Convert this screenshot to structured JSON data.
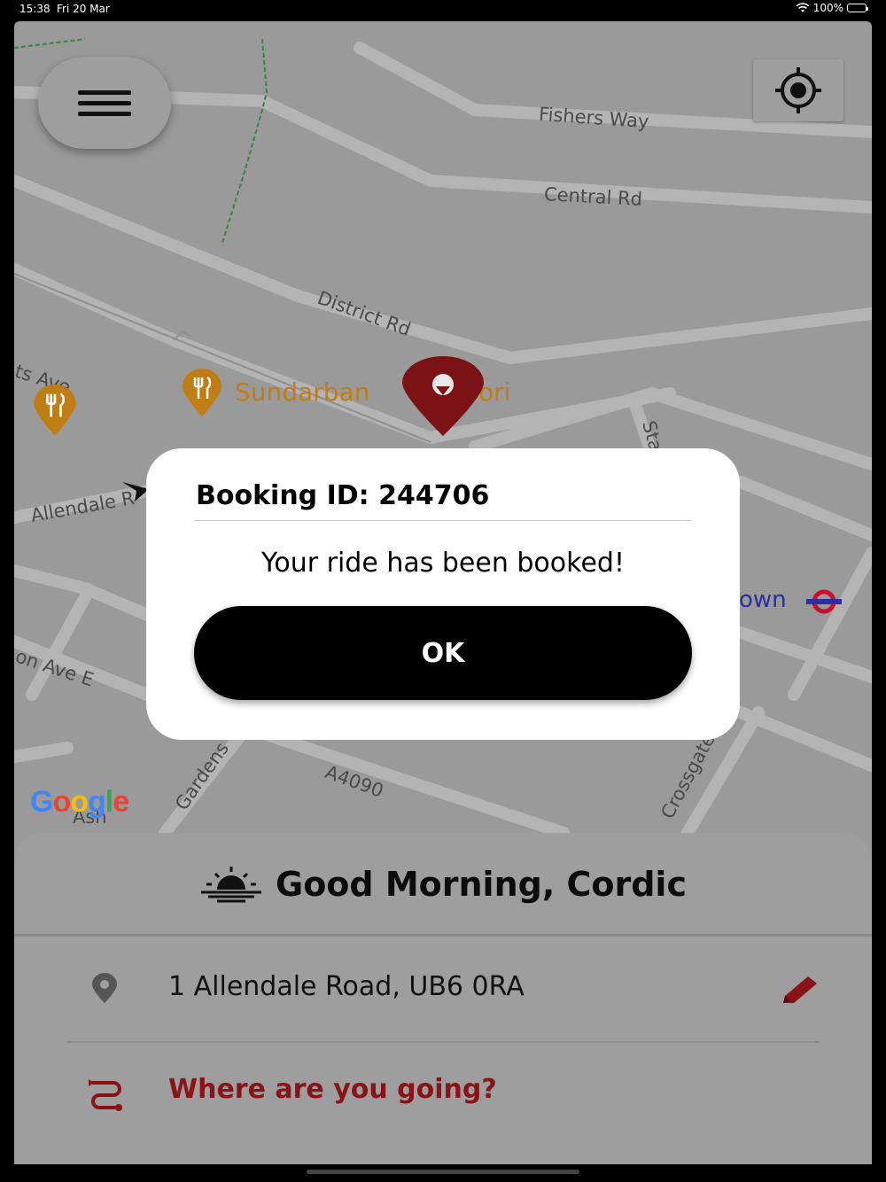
{
  "status_bar": {
    "time": "15:38",
    "date": "Fri 20 Mar",
    "battery": "100%"
  },
  "map": {
    "streets": [
      "Fishers Way",
      "Central Rd",
      "District Rd",
      "Allendale R",
      "on Ave E",
      "A4090",
      "Gardens",
      "Crossgate",
      "Stat",
      "ts Ave",
      "Ash"
    ],
    "pois": [
      "Sundarban",
      "ori"
    ],
    "station": "own",
    "attribution": "Google"
  },
  "dialog": {
    "title": "Booking ID: 244706",
    "message": "Your ride has been booked!",
    "ok_label": "OK"
  },
  "panel": {
    "greeting": "Good Morning, Cordic",
    "pickup": "1 Allendale Road, UB6 0RA",
    "destination_prompt": "Where are you going?"
  },
  "colors": {
    "accent": "#8a1318",
    "map_bg": "#9a9a9a",
    "poi": "#c07d12"
  },
  "icons": [
    "menu-icon",
    "locate-icon",
    "sunrise-icon",
    "location-pin-icon",
    "edit-pencil-icon",
    "route-icon",
    "restaurant-icon",
    "map-marker-icon",
    "underground-icon"
  ]
}
